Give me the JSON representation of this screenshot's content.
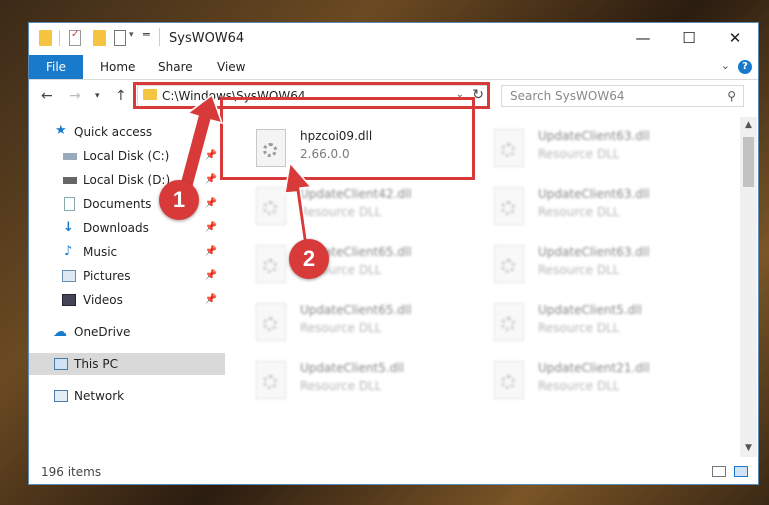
{
  "window": {
    "title": "SysWOW64",
    "controls": {
      "minimize": "—",
      "maximize": "☐",
      "close": "✕"
    }
  },
  "ribbon": {
    "file": "File",
    "tabs": [
      "Home",
      "Share",
      "View"
    ],
    "help": "?"
  },
  "address": {
    "path": "C:\\Windows\\SysWOW64",
    "search_placeholder": "Search SysWOW64"
  },
  "nav": {
    "items": [
      {
        "label": "Quick access",
        "icon": "star-icon",
        "pinned": false
      },
      {
        "label": "Local Disk (C:)",
        "icon": "drive-icon",
        "pinned": true
      },
      {
        "label": "Local Disk (D:)",
        "icon": "drive-icon",
        "pinned": true
      },
      {
        "label": "Documents",
        "icon": "documents-icon",
        "pinned": true
      },
      {
        "label": "Downloads",
        "icon": "download-icon",
        "pinned": true
      },
      {
        "label": "Music",
        "icon": "music-icon",
        "pinned": true
      },
      {
        "label": "Pictures",
        "icon": "pictures-icon",
        "pinned": true
      },
      {
        "label": "Videos",
        "icon": "videos-icon",
        "pinned": true
      },
      {
        "label": "OneDrive",
        "icon": "cloud-icon",
        "pinned": false
      },
      {
        "label": "This PC",
        "icon": "computer-icon",
        "pinned": false,
        "selected": true
      },
      {
        "label": "Network",
        "icon": "network-icon",
        "pinned": false
      }
    ]
  },
  "files": [
    {
      "name": "hpzcoi09.dll",
      "sub": "2.66.0.0"
    },
    {
      "name": "UpdateClient63.dll",
      "sub": "Resource DLL"
    },
    {
      "name": "UpdateClient42.dll",
      "sub": "Resource DLL"
    },
    {
      "name": "UpdateClient63.dll",
      "sub": "Resource DLL"
    },
    {
      "name": "UpdateClient65.dll",
      "sub": "Resource DLL"
    },
    {
      "name": "UpdateClient63.dll",
      "sub": "Resource DLL"
    },
    {
      "name": "UpdateClient65.dll",
      "sub": "Resource DLL"
    },
    {
      "name": "UpdateClient5.dll",
      "sub": "Resource DLL"
    },
    {
      "name": "UpdateClient5.dll",
      "sub": "Resource DLL"
    },
    {
      "name": "UpdateClient21.dll",
      "sub": "Resource DLL"
    }
  ],
  "status": {
    "count": "196 items"
  },
  "callouts": {
    "one": "1",
    "two": "2"
  },
  "colors": {
    "accent": "#1979ca",
    "highlight": "#d83a3a"
  }
}
